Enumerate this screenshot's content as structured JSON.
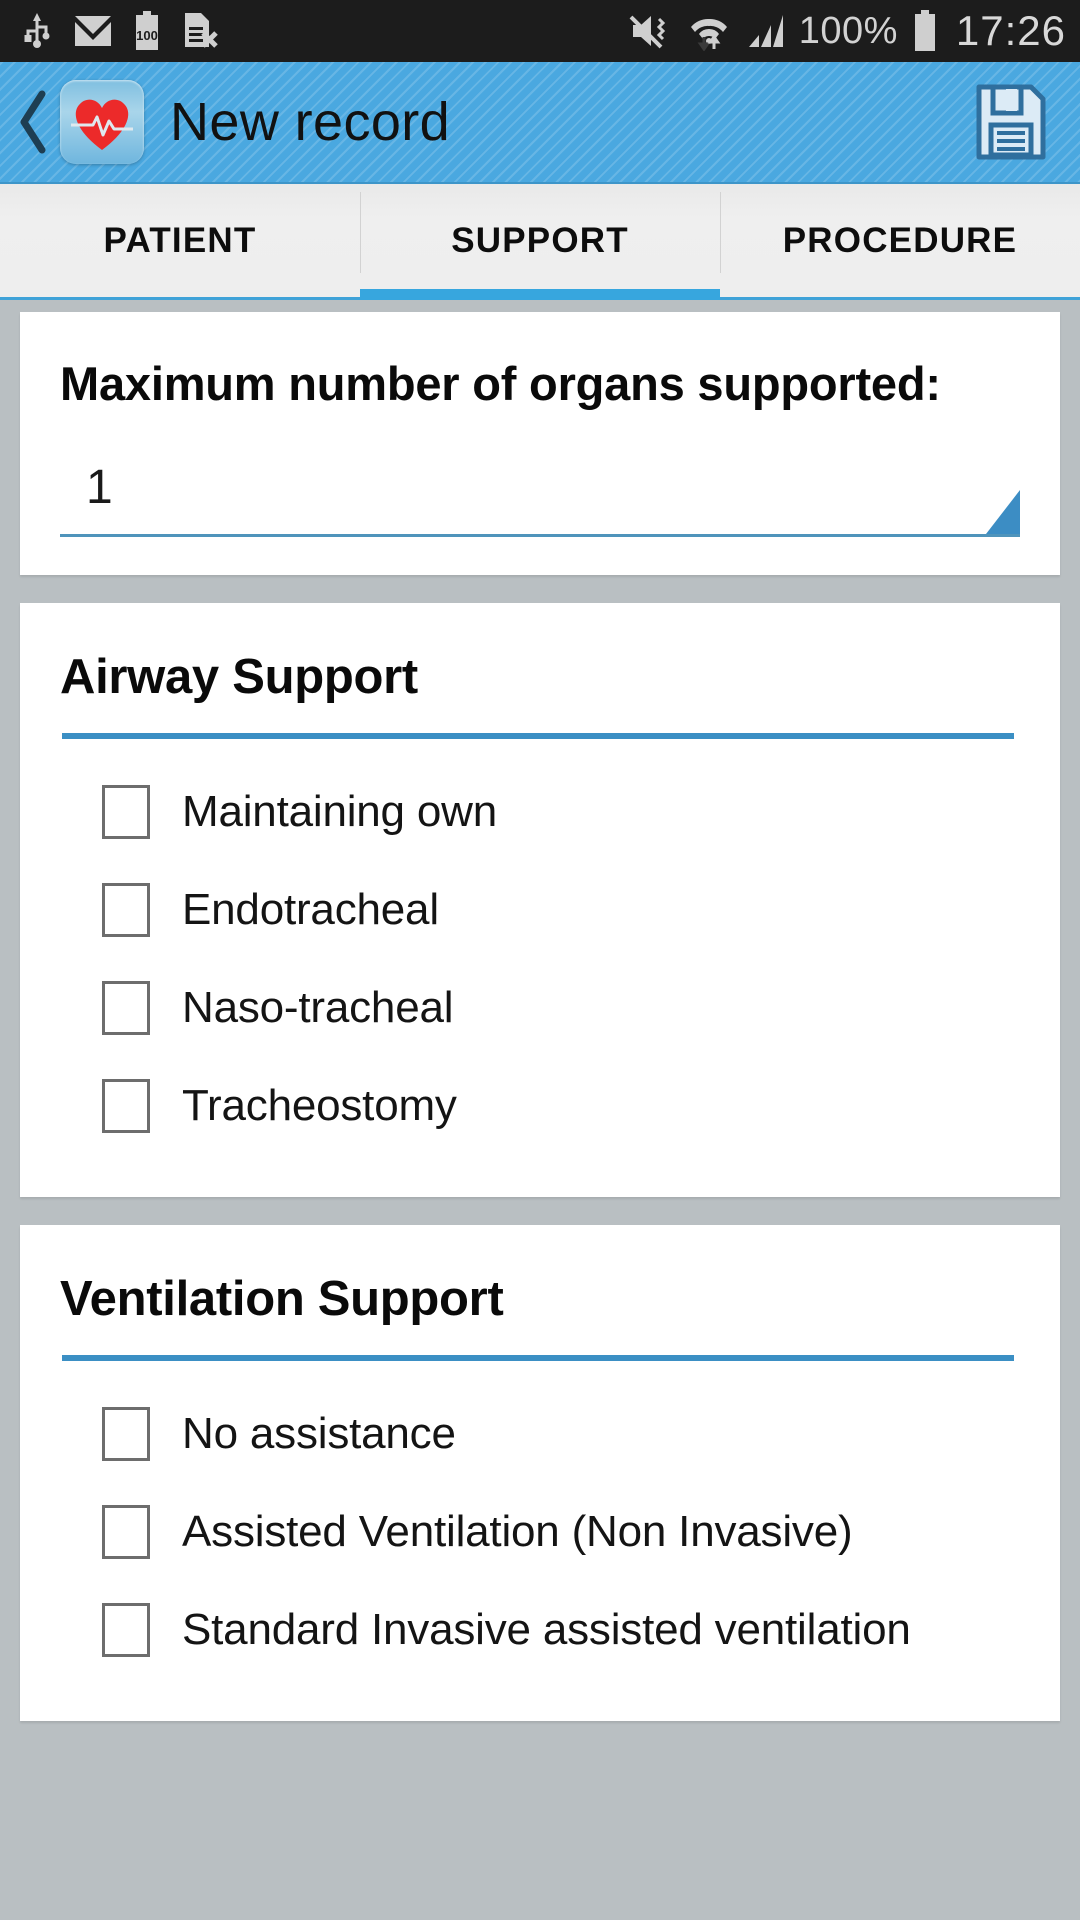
{
  "status_bar": {
    "left_icons": [
      "usb-icon",
      "gmail-icon",
      "battery-100-icon",
      "sim-card-error-icon"
    ],
    "right_icons": [
      "vibrate-mute-icon",
      "wifi-data-icon",
      "signal-bars-icon",
      "battery-icon"
    ],
    "battery_percent": "100%",
    "clock": "17:26"
  },
  "action_bar": {
    "back_icon": "back-chevron-icon",
    "app_icon": "heart-ecg-app-icon",
    "title": "New record",
    "save_icon": "floppy-disk-save-icon"
  },
  "tabs": [
    {
      "label": "PATIENT",
      "selected": false
    },
    {
      "label": "SUPPORT",
      "selected": true
    },
    {
      "label": "PROCEDURE",
      "selected": false
    }
  ],
  "organs_field": {
    "label": "Maximum number of organs supported:",
    "value": "1",
    "dropdown_icon": "spinner-triangle-icon"
  },
  "sections": [
    {
      "title": "Airway Support",
      "options": [
        {
          "label": "Maintaining own",
          "checked": false
        },
        {
          "label": "Endotracheal",
          "checked": false
        },
        {
          "label": "Naso-tracheal",
          "checked": false
        },
        {
          "label": "Tracheostomy",
          "checked": false
        }
      ]
    },
    {
      "title": "Ventilation Support",
      "options": [
        {
          "label": "No assistance",
          "checked": false
        },
        {
          "label": "Assisted Ventilation (Non Invasive)",
          "checked": false
        },
        {
          "label": "Standard Invasive assisted ventilation",
          "checked": false
        }
      ]
    }
  ],
  "colors": {
    "accent_blue": "#4aa8e0",
    "tab_indicator": "#37a6de",
    "rule_blue": "#3b8fc4",
    "page_background": "#b9bfc2",
    "status_bar": "#1c1c1c",
    "heart_red": "#ec2a2a"
  }
}
